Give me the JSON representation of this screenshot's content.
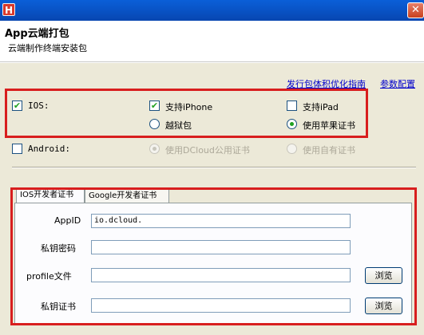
{
  "window": {
    "app_icon_letter": "H",
    "close_glyph": "✕"
  },
  "header": {
    "title": "App云端打包",
    "subtitle": "云端制作终端安装包"
  },
  "links": {
    "guide": "发行包体积优化指南",
    "params": "参数配置"
  },
  "ios": {
    "label": "IOS:",
    "checked": true,
    "iphone": {
      "label": "支持iPhone",
      "checked": true
    },
    "ipad": {
      "label": "支持iPad",
      "checked": false
    },
    "jailbreak": {
      "label": "越狱包",
      "selected": false
    },
    "apple_cert": {
      "label": "使用苹果证书",
      "selected": true
    }
  },
  "android": {
    "label": "Android:",
    "checked": false,
    "dcloud_cert": {
      "label": "使用DCloud公用证书",
      "selected": true,
      "disabled": true
    },
    "own_cert": {
      "label": "使用自有证书",
      "selected": false,
      "disabled": true
    }
  },
  "tabs": [
    {
      "label": "IOS开发者证书",
      "active": true
    },
    {
      "label": "Google开发者证书",
      "active": false
    }
  ],
  "form": {
    "appid": {
      "label": "AppID",
      "value": "io.dcloud."
    },
    "key_password": {
      "label": "私钥密码",
      "value": ""
    },
    "profile": {
      "label": "profile文件",
      "value": "",
      "button": "浏览"
    },
    "key_cert": {
      "label": "私钥证书",
      "value": "",
      "button": "浏览"
    }
  },
  "colors": {
    "annotation": "#d81e1e",
    "titlebar": "#0955c9",
    "link": "#0000cc"
  }
}
